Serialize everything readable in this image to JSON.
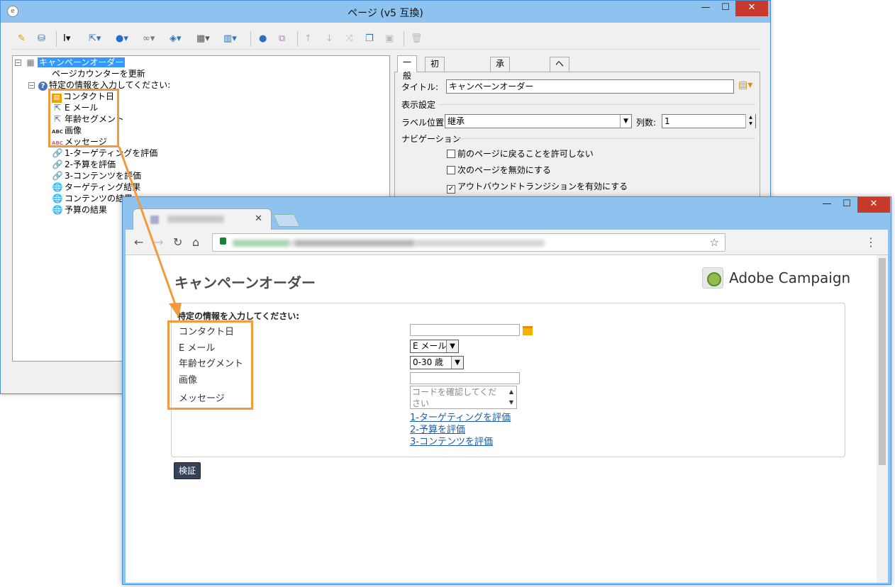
{
  "console": {
    "title": "ページ (v5 互換)",
    "tree": [
      {
        "label": "キャンペーンオーダー",
        "icon": "table-icon",
        "glyph": "▦"
      },
      {
        "label": "ページカウンターを更新",
        "icon": "",
        "glyph": ""
      },
      {
        "label": "特定の情報を入力してください:",
        "icon": "question-icon",
        "glyph": "?"
      },
      {
        "label": "コンタクト日",
        "icon": "calendar-icon",
        "glyph": "▤"
      },
      {
        "label": "E メール",
        "icon": "cursor-icon",
        "glyph": "⇱"
      },
      {
        "label": "年齢セグメント",
        "icon": "cursor-icon",
        "glyph": "⇱"
      },
      {
        "label": "画像",
        "icon": "abc-icon",
        "glyph": "ABC"
      },
      {
        "label": "メッセージ",
        "icon": "abc-icon",
        "glyph": "ABC"
      },
      {
        "label": "1-ターゲティングを評価",
        "icon": "link-icon",
        "glyph": "🔗"
      },
      {
        "label": "2-予算を評価",
        "icon": "link-icon",
        "glyph": "🔗"
      },
      {
        "label": "3-コンテンツを評価",
        "icon": "link-icon",
        "glyph": "🔗"
      },
      {
        "label": "ターゲティング結果",
        "icon": "globe-icon",
        "glyph": "🌐"
      },
      {
        "label": "コンテンツの結果",
        "icon": "globe-icon",
        "glyph": "🌐"
      },
      {
        "label": "予算の結果",
        "icon": "globe-icon",
        "glyph": "🌐"
      }
    ],
    "tabs": [
      "一般",
      "初期化スクリプト",
      "承認スクリプト",
      "ヘッダー"
    ],
    "props": {
      "title_label": "タイトル:",
      "title_value": "キャンペーンオーダー",
      "display_section": "表示設定",
      "label_pos_label": "ラベル位置:",
      "label_pos_value": "継承",
      "columns_label": "列数:",
      "columns_value": "1",
      "nav_section": "ナビゲーション",
      "checks": [
        {
          "label": "前のページに戻ることを許可しない",
          "checked": false
        },
        {
          "label": "次のページを無効にする",
          "checked": false
        },
        {
          "label": "アウトバウンドトランジションを有効にする",
          "checked": true
        }
      ]
    }
  },
  "browser": {
    "page_title": "キャンペーンオーダー",
    "logo_text": "Adobe Campaign",
    "form_heading": "特定の情報を入力してください:",
    "labels": [
      "コンタクト日",
      "E メール",
      "年齢セグメント",
      "画像",
      "メッセージ"
    ],
    "email_select": "E メール",
    "age_select": "0-30 歳",
    "message_placeholder": "コードを確認してください",
    "links": [
      "1-ターゲティングを評価",
      "2-予算を評価",
      "3-コンテンツを評価"
    ],
    "verify_button": "検証"
  },
  "colors": {
    "accent_orange": "#f39a3c",
    "title_bar": "#8ec3f0",
    "selection": "#3399ff",
    "button_dark": "#35425a",
    "link_blue": "#1a5ca8"
  }
}
